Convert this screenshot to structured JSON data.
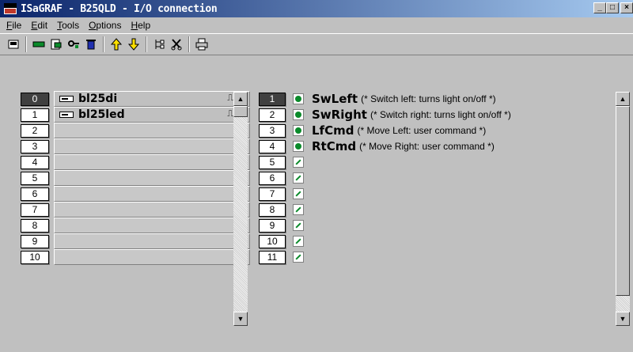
{
  "window": {
    "title": "ISaGRAF - B25QLD - I/O connection",
    "buttons": {
      "minimize": "_",
      "maximize": "□",
      "close": "×"
    }
  },
  "menu": [
    {
      "label": "File",
      "accel": "F",
      "rest": "ile"
    },
    {
      "label": "Edit",
      "accel": "E",
      "rest": "dit"
    },
    {
      "label": "Tools",
      "accel": "T",
      "rest": "ools"
    },
    {
      "label": "Options",
      "accel": "O",
      "rest": "ptions"
    },
    {
      "label": "Help",
      "accel": "H",
      "rest": "elp"
    }
  ],
  "toolbar": {
    "icons": [
      "board-icon",
      "connect-icon",
      "open-icon",
      "key-icon",
      "trash-icon",
      "up-arrow-icon",
      "down-arrow-icon",
      "tree-icon",
      "cut-icon",
      "print-icon"
    ]
  },
  "boards": [
    {
      "index": "0",
      "name": "bl25di",
      "direction": "⎍ ←",
      "selected": true
    },
    {
      "index": "1",
      "name": "bl25led",
      "direction": "⎍ →",
      "selected": false
    },
    {
      "index": "2",
      "name": "",
      "direction": "",
      "selected": false
    },
    {
      "index": "3",
      "name": "",
      "direction": "",
      "selected": false
    },
    {
      "index": "4",
      "name": "",
      "direction": "",
      "selected": false
    },
    {
      "index": "5",
      "name": "",
      "direction": "",
      "selected": false
    },
    {
      "index": "6",
      "name": "",
      "direction": "",
      "selected": false
    },
    {
      "index": "7",
      "name": "",
      "direction": "",
      "selected": false
    },
    {
      "index": "8",
      "name": "",
      "direction": "",
      "selected": false
    },
    {
      "index": "9",
      "name": "",
      "direction": "",
      "selected": false
    },
    {
      "index": "10",
      "name": "",
      "direction": "",
      "selected": false
    }
  ],
  "channels": [
    {
      "index": "1",
      "name": "SwLeft",
      "comment": "(* Switch left: turns light on/off *)",
      "selected": true
    },
    {
      "index": "2",
      "name": "SwRight",
      "comment": "(* Switch right: turns light on/off *)",
      "selected": false
    },
    {
      "index": "3",
      "name": "LfCmd",
      "comment": "(* Move Left: user command *)",
      "selected": false
    },
    {
      "index": "4",
      "name": "RtCmd",
      "comment": "(* Move Right: user command *)",
      "selected": false
    },
    {
      "index": "5",
      "name": "",
      "comment": "",
      "selected": false
    },
    {
      "index": "6",
      "name": "",
      "comment": "",
      "selected": false
    },
    {
      "index": "7",
      "name": "",
      "comment": "",
      "selected": false
    },
    {
      "index": "8",
      "name": "",
      "comment": "",
      "selected": false
    },
    {
      "index": "9",
      "name": "",
      "comment": "",
      "selected": false
    },
    {
      "index": "10",
      "name": "",
      "comment": "",
      "selected": false
    },
    {
      "index": "11",
      "name": "",
      "comment": "",
      "selected": false
    }
  ]
}
